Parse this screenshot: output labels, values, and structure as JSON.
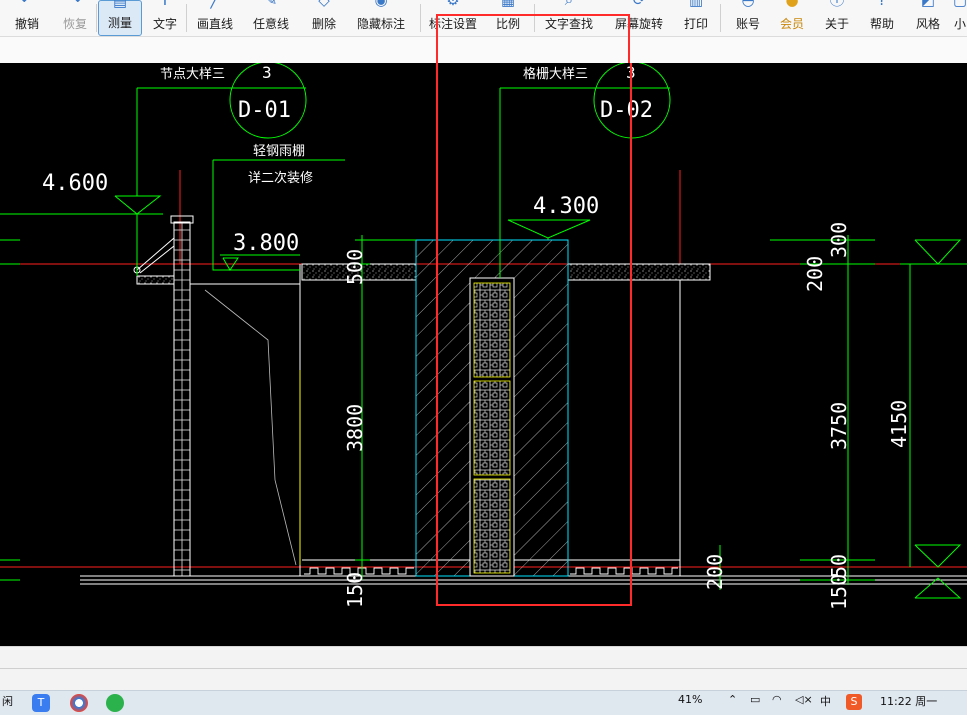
{
  "toolbar": {
    "items": [
      {
        "label": "撤销",
        "icon": "undo-icon"
      },
      {
        "label": "恢复",
        "icon": "redo-icon"
      },
      {
        "label": "测量",
        "icon": "ruler-icon"
      },
      {
        "label": "文字",
        "icon": "text-icon"
      },
      {
        "label": "画直线",
        "icon": "line-icon"
      },
      {
        "label": "任意线",
        "icon": "pen-icon"
      },
      {
        "label": "删除",
        "icon": "eraser-icon"
      },
      {
        "label": "隐藏标注",
        "icon": "eye-icon"
      },
      {
        "label": "标注设置",
        "icon": "gear-icon"
      },
      {
        "label": "比例",
        "icon": "scale-icon"
      },
      {
        "label": "文字查找",
        "icon": "search-text-icon"
      },
      {
        "label": "屏幕旋转",
        "icon": "rotate-icon"
      },
      {
        "label": "打印",
        "icon": "printer-icon"
      },
      {
        "label": "账号",
        "icon": "user-icon"
      },
      {
        "label": "会员",
        "icon": "vip-icon"
      },
      {
        "label": "关于",
        "icon": "info-icon"
      },
      {
        "label": "帮助",
        "icon": "help-icon"
      },
      {
        "label": "风格",
        "icon": "style-icon"
      },
      {
        "label": "小",
        "icon": "mini-icon"
      }
    ],
    "active": "测量",
    "disabled": "恢复"
  },
  "drawing": {
    "detail_left": {
      "title": "节点大样三",
      "number": "3",
      "sheet": "D-01"
    },
    "detail_right": {
      "title": "格栅大样三",
      "number": "3",
      "sheet": "D-02"
    },
    "note_canopy": "轻钢雨棚",
    "note_decor": "详二次装修",
    "elev_4600": "4.600",
    "elev_3800": "3.800",
    "elev_4300": "4.300",
    "dim_500": "500",
    "dim_3800": "3800",
    "dim_150_left": "150",
    "dim_200_mid": "200",
    "dim_300": "300",
    "dim_200_right": "200",
    "dim_3750": "3750",
    "dim_4150": "4150",
    "dim_50": "50",
    "dim_150_right": "150",
    "colors": {
      "background": "#000000",
      "dim_line": "#00ff00",
      "elev_line": "#ff2020",
      "wall": "#ffffff",
      "cyan": "#00e5ff",
      "yellow": "#ffff00",
      "highlight": "#ff2a2a"
    }
  },
  "taskbar": {
    "start_label": "闲",
    "percent": "41%",
    "ime": "中",
    "time": "11:22 周一",
    "apps": [
      "tencent-meeting-icon",
      "browser-icon",
      "wechat-icon"
    ]
  }
}
